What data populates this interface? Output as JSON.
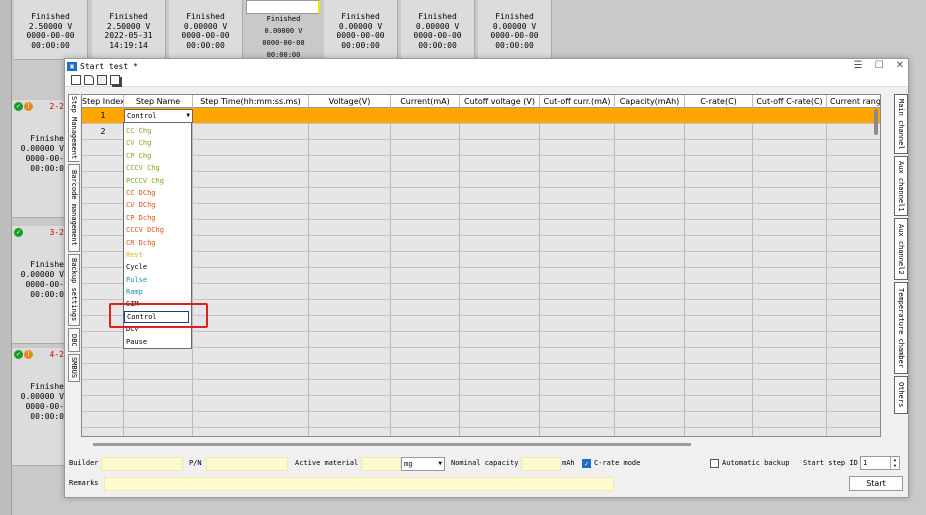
{
  "background": {
    "top_tiles": [
      {
        "status": "Finished",
        "voltage": "2.50000 V",
        "date": "0000-00-00",
        "time": "00:00:00"
      },
      {
        "status": "Finished",
        "voltage": "2.50000 V",
        "date": "2022-05-31",
        "time": "14:19:14"
      },
      {
        "status": "Finished",
        "voltage": "0.00000 V",
        "date": "0000-00-00",
        "time": "00:00:00"
      },
      {
        "status": "Finished",
        "voltage": "0.00000 V",
        "date": "0000-00-00",
        "time": "00:00:00"
      },
      {
        "status": "Finished",
        "voltage": "0.00000 V",
        "date": "0000-00-00",
        "time": "00:00:00"
      },
      {
        "status": "Finished",
        "voltage": "0.00000 V",
        "date": "0000-00-00",
        "time": "00:00:00"
      },
      {
        "status": "Finished",
        "voltage": "0.00000 V",
        "date": "0000-00-00",
        "time": "00:00:00"
      }
    ],
    "side_tiles": [
      {
        "channel": "2-2",
        "status": "Finishe",
        "voltage": "0.00000 V",
        "date": "0000-00-",
        "time": "00:00:0"
      },
      {
        "channel": "3-2",
        "status": "Finishe",
        "voltage": "0.00000 V",
        "date": "0000-00-",
        "time": "00:00:0"
      },
      {
        "channel": "4-2",
        "status": "Finishe",
        "voltage": "0.00000 V",
        "date": "0000-00-",
        "time": "00:00:0"
      }
    ]
  },
  "dialog": {
    "title": "Start test *",
    "window_buttons": {
      "minimize": "☰",
      "maximize": "☐",
      "close": "✕"
    },
    "left_tabs": [
      "Step Management",
      "Barcode management",
      "Backup settings",
      "DBC",
      "SMBUS"
    ],
    "right_tabs": [
      "Main channel",
      "Aux channel1",
      "Aux channel2",
      "Temperature chamber",
      "Others"
    ],
    "columns": [
      "Step Index",
      "Step Name",
      "Step Time(hh:mm:ss.ms)",
      "Voltage(V)",
      "Current(mA)",
      "Cutoff voltage (V)",
      "Cut-off curr.(mA)",
      "Capacity(mAh)",
      "C-rate(C)",
      "Cut-off C-rate(C)",
      "Current rang"
    ],
    "rows": [
      {
        "index": "1",
        "step_name": "Control"
      },
      {
        "index": "2",
        "step_name": ""
      }
    ],
    "dropdown_options": [
      {
        "label": "CC Chg",
        "color": "#7aa820"
      },
      {
        "label": "CV Chg",
        "color": "#7aa820"
      },
      {
        "label": "CP Chg",
        "color": "#7aa820"
      },
      {
        "label": "CCCV Chg",
        "color": "#7aa820"
      },
      {
        "label": "PCCCV Chg",
        "color": "#7aa820"
      },
      {
        "label": "CC DChg",
        "color": "#e0501a"
      },
      {
        "label": "CV DChg",
        "color": "#e0501a"
      },
      {
        "label": "CP Dchg",
        "color": "#e0501a"
      },
      {
        "label": "CCCV DChg",
        "color": "#e0501a"
      },
      {
        "label": "CR Dchg",
        "color": "#e0501a"
      },
      {
        "label": "Rest",
        "color": "#e8b020"
      },
      {
        "label": "Cycle",
        "color": "#000000"
      },
      {
        "label": "Pulse",
        "color": "#1a8ac8"
      },
      {
        "label": "Ramp",
        "color": "#1a8ac8"
      },
      {
        "label": "SIM",
        "color": "#000000"
      },
      {
        "label": "Control",
        "color": "#000000"
      },
      {
        "label": "DCV",
        "color": "#000000"
      },
      {
        "label": "Pause",
        "color": "#000000"
      }
    ],
    "focused_option": "Control",
    "form": {
      "builder_label": "Builder",
      "pn_label": "P/N",
      "active_material_label": "Active material",
      "unit_value": "mg",
      "nominal_capacity_label": "Nominal capacity",
      "capacity_unit": "mAh",
      "crate_mode_label": "C-rate mode",
      "crate_mode_checked": true,
      "auto_backup_label": "Automatic backup",
      "auto_backup_checked": false,
      "start_step_label": "Start step ID",
      "start_step_value": "1",
      "remarks_label": "Remarks",
      "start_button": "Start"
    }
  },
  "colors": {
    "selected_row": "#ffa600",
    "highlight_box": "#e02020",
    "input_fill": "#fffacd",
    "accent": "#1e6fc4"
  }
}
